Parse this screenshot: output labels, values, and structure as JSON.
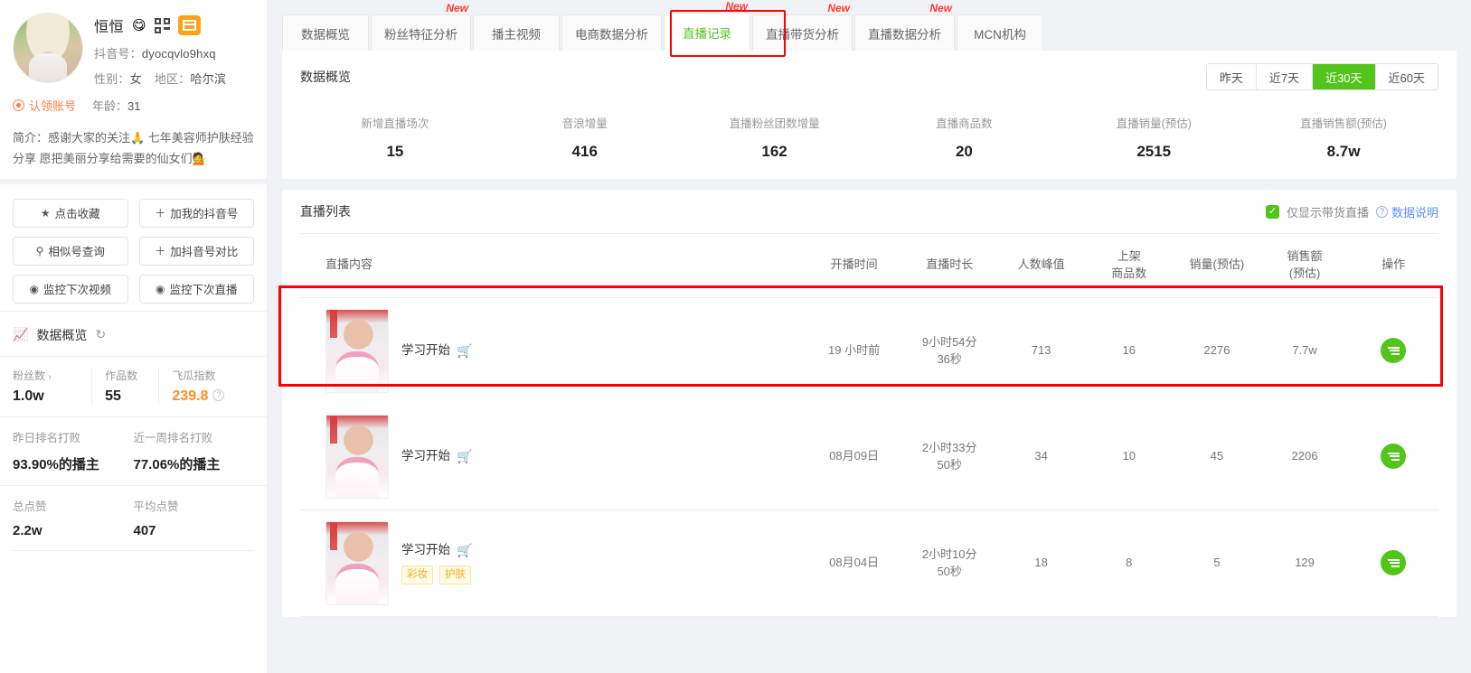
{
  "sidebar": {
    "profile": {
      "nickname": "恒恒",
      "nickname_emoji": "😋",
      "qr_icon": "qr-code-icon",
      "shop_icon": "shop-icon",
      "douyin_id_label": "抖音号：",
      "douyin_id": "dyocqvlo9hxq",
      "gender_label": "性别：",
      "gender": "女",
      "region_label": "地区：",
      "region": "哈尔滨",
      "claim_label": "认领账号",
      "age_label": "年龄：",
      "age": "31",
      "bio": "简介：感谢大家的关注🙏 七年美容师护肤经验分享 愿把美丽分享给需要的仙女们💁"
    },
    "actions": [
      {
        "label": "点击收藏",
        "icon": "star-icon",
        "glyph": "★"
      },
      {
        "label": "加我的抖音号",
        "icon": "plus-icon",
        "glyph": "＋"
      },
      {
        "label": "相似号查询",
        "icon": "search-icon",
        "glyph": "🔍"
      },
      {
        "label": "加抖音号对比",
        "icon": "plus-icon",
        "glyph": "＋"
      },
      {
        "label": "监控下次视频",
        "icon": "eye-icon",
        "glyph": "◉"
      },
      {
        "label": "监控下次直播",
        "icon": "eye-icon",
        "glyph": "◉"
      }
    ],
    "overview": {
      "title": "数据概览",
      "chart_icon": "chart-icon",
      "refresh_icon": "refresh-icon",
      "refresh_glyph": "↻"
    },
    "stats_primary": [
      {
        "label": "粉丝数",
        "value": "1.0w",
        "has_caret": true
      },
      {
        "label": "作品数",
        "value": "55",
        "has_caret": false
      },
      {
        "label": "飞瓜指数",
        "value": "239.8",
        "has_caret": false,
        "accent": true,
        "help": "?"
      }
    ],
    "stats_rank": [
      {
        "label": "昨日排名打败",
        "value": "93.90%的播主"
      },
      {
        "label": "近一周排名打败",
        "value": "77.06%的播主"
      }
    ],
    "stats_likes": [
      {
        "label": "总点赞",
        "value": "2.2w"
      },
      {
        "label": "平均点赞",
        "value": "407"
      }
    ]
  },
  "tabs": [
    {
      "label": "数据概览",
      "new": false,
      "active": false
    },
    {
      "label": "粉丝特征分析",
      "new": true,
      "active": false
    },
    {
      "label": "播主视频",
      "new": false,
      "active": false
    },
    {
      "label": "电商数据分析",
      "new": false,
      "active": false
    },
    {
      "label": "直播记录",
      "new": true,
      "active": true
    },
    {
      "label": "直播带货分析",
      "new": true,
      "active": false
    },
    {
      "label": "直播数据分析",
      "new": true,
      "active": false
    },
    {
      "label": "MCN机构",
      "new": false,
      "active": false
    }
  ],
  "new_badge_text": "New",
  "overview_panel": {
    "title": "数据概览",
    "ranges": [
      {
        "label": "昨天",
        "active": false
      },
      {
        "label": "近7天",
        "active": false
      },
      {
        "label": "近30天",
        "active": true
      },
      {
        "label": "近60天",
        "active": false
      }
    ],
    "metrics": [
      {
        "label": "新增直播场次",
        "value": "15"
      },
      {
        "label": "音浪增量",
        "value": "416"
      },
      {
        "label": "直播粉丝团数增量",
        "value": "162"
      },
      {
        "label": "直播商品数",
        "value": "20"
      },
      {
        "label": "直播销量(预估)",
        "value": "2515"
      },
      {
        "label": "直播销售额(预估)",
        "value": "8.7w"
      }
    ]
  },
  "list_panel": {
    "title": "直播列表",
    "checkbox_label": "仅显示带货直播",
    "checkbox_checked": true,
    "data_note": "数据说明",
    "columns": [
      "直播内容",
      "开播时间",
      "直播时长",
      "人数峰值",
      "上架\n商品数",
      "销量(预估)",
      "销售额\n(预估)",
      "操作"
    ],
    "columns_split": [
      {
        "l1": "直播内容",
        "l2": ""
      },
      {
        "l1": "开播时间",
        "l2": ""
      },
      {
        "l1": "直播时长",
        "l2": ""
      },
      {
        "l1": "人数峰值",
        "l2": ""
      },
      {
        "l1": "上架",
        "l2": "商品数"
      },
      {
        "l1": "销量(预估)",
        "l2": ""
      },
      {
        "l1": "销售额",
        "l2": "(预估)"
      },
      {
        "l1": "操作",
        "l2": ""
      }
    ],
    "rows": [
      {
        "title": "学习开始",
        "cart": true,
        "tags": [],
        "start_time": "19 小时前",
        "duration_l1": "9小时54分",
        "duration_l2": "36秒",
        "peak_viewers": "713",
        "product_count": "16",
        "sales_volume": "2276",
        "sales_amount": "7.7w",
        "highlighted": true
      },
      {
        "title": "学习开始",
        "cart": true,
        "tags": [],
        "start_time": "08月09日",
        "duration_l1": "2小时33分",
        "duration_l2": "50秒",
        "peak_viewers": "34",
        "product_count": "10",
        "sales_volume": "45",
        "sales_amount": "2206",
        "highlighted": false
      },
      {
        "title": "学习开始",
        "cart": true,
        "tags": [
          "彩妆",
          "护肤"
        ],
        "start_time": "08月04日",
        "duration_l1": "2小时10分",
        "duration_l2": "50秒",
        "peak_viewers": "18",
        "product_count": "8",
        "sales_volume": "5",
        "sales_amount": "129",
        "highlighted": false
      }
    ]
  },
  "colors": {
    "accent_green": "#52c41a",
    "accent_orange": "#ff8f1f",
    "highlight_red": "#ff0000",
    "link_blue": "#5b8ff9",
    "cart_red": "#ff4d4f",
    "tag_yellow": "#faad14"
  }
}
